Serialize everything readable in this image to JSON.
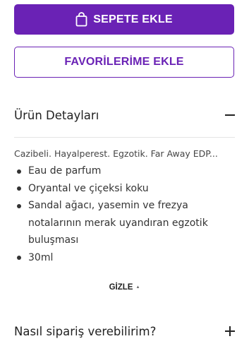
{
  "actions": {
    "add_to_cart_label": "SEPETE EKLE",
    "favorites_label": "FAVORİLERİME EKLE",
    "cart_icon": "shopping-bag-icon"
  },
  "product_details": {
    "title": "Ürün Detayları",
    "toggle_icon": "minus-icon",
    "summary": "Cazibeli. Hayalperest. Egzotik. Far Away EDP...",
    "features": [
      "Eau de parfum",
      "Oryantal ve çiçeksi koku",
      "Sandal ağacı, yasemin ve frezya notalarının merak uyandıran egzotik buluşması",
      "30ml"
    ],
    "hide_label": "GİZLE",
    "hide_icon": "caret-up-icon"
  },
  "order_help": {
    "title": "Nasıl sipariş verebilirim?",
    "toggle_icon": "plus-icon"
  },
  "colors": {
    "brand_purple": "#6a22b5",
    "text": "#222222"
  }
}
